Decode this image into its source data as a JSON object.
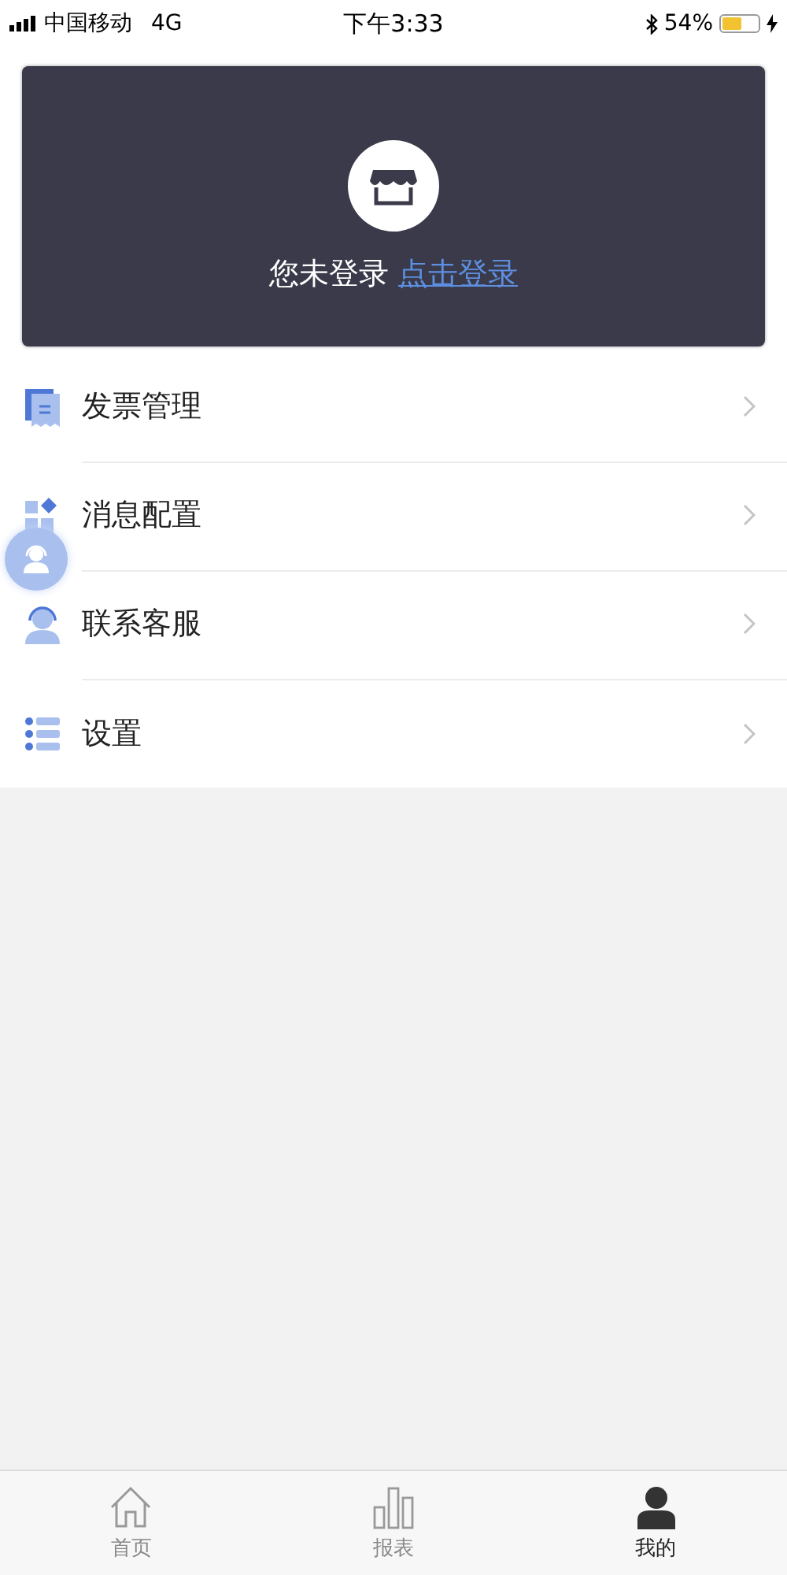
{
  "status_bar": {
    "carrier": "中国移动",
    "network": "4G",
    "time": "下午3:33",
    "battery": "54%"
  },
  "login_card": {
    "status": "您未登录",
    "link": "点击登录"
  },
  "menu": [
    {
      "kind": "invoice",
      "label": "发票管理"
    },
    {
      "kind": "message",
      "label": "消息配置"
    },
    {
      "kind": "service",
      "label": "联系客服"
    },
    {
      "kind": "settings",
      "label": "设置"
    }
  ],
  "tabs": [
    {
      "kind": "home",
      "label": "首页",
      "selected": false
    },
    {
      "kind": "report",
      "label": "报表",
      "selected": false
    },
    {
      "kind": "profile",
      "label": "我的",
      "selected": true
    }
  ]
}
